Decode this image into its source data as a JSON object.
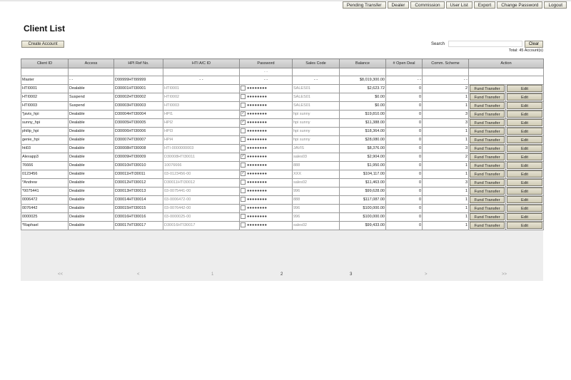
{
  "nav": {
    "items": [
      "Pending Transfer",
      "Dealer",
      "Commission",
      "User List",
      "Export",
      "Change Password",
      "Logout"
    ]
  },
  "page": {
    "title": "Client List",
    "create_label": "Create Account",
    "search_label": "Search",
    "search_value": "",
    "clear_label": "Clear",
    "total": "Total: 45 Account(s)"
  },
  "table": {
    "headers": [
      "Client ID",
      "Access",
      "HPI Ref No.",
      "HTI A/C ID",
      "Password",
      "Sales Code",
      "Balance",
      "# Open Deal",
      "Comm. Scheme",
      "Action"
    ],
    "filter_password": "- -",
    "master": {
      "client_id": "Master",
      "access": "- -",
      "ref": "D99999HTI99999",
      "ac": "- -",
      "password": "- -",
      "sales": "- -",
      "balance": "$8,019,300.00",
      "open": "- -",
      "comm": "- -"
    },
    "password_mask": "●●●●●●●●",
    "fund_label": "Fund Transfer",
    "edit_label": "Edit",
    "rows": [
      {
        "id": "HTI0001",
        "access": "Dealable",
        "ref": "D30001HTI30001",
        "ac": "HTI0001",
        "checked": false,
        "sales": "SALES01",
        "balance": "$2,623.72",
        "open": "0",
        "comm": "2"
      },
      {
        "id": "HTI0002",
        "access": "Suspend",
        "ref": "D30002HTI30002",
        "ac": "HTI0002",
        "checked": false,
        "sales": "SALES01",
        "balance": "$0.00",
        "open": "0",
        "comm": "1"
      },
      {
        "id": "HTI0003",
        "access": "Suspend",
        "ref": "D30003HTI30003",
        "ac": "HTI0003",
        "checked": false,
        "sales": "SALES01",
        "balance": "$0.00",
        "open": "0",
        "comm": "1"
      },
      {
        "id": "*javis_hpi",
        "access": "Dealable",
        "ref": "D30004HTI30004",
        "ac": "HPI1",
        "checked": true,
        "sales": "hpi sunny",
        "balance": "$19,810.00",
        "open": "0",
        "comm": "3"
      },
      {
        "id": "sunny_hpi",
        "access": "Dealable",
        "ref": "D30005HTI30005",
        "ac": "HPI2",
        "checked": true,
        "sales": "hpi sunny",
        "balance": "$11,388.00",
        "open": "0",
        "comm": "3"
      },
      {
        "id": "philip_hpi",
        "access": "Dealable",
        "ref": "D30006HTI30006",
        "ac": "HPI3",
        "checked": false,
        "sales": "hpi sunny",
        "balance": "$18,364.00",
        "open": "0",
        "comm": "1"
      },
      {
        "id": "genie_hpi",
        "access": "Dealable",
        "ref": "D30007HTI30007",
        "ac": "HPI4",
        "checked": false,
        "sales": "hpi sunny",
        "balance": "$28,080.00",
        "open": "0",
        "comm": "1"
      },
      {
        "id": "hti03",
        "access": "Dealable",
        "ref": "D30008HTI30008",
        "ac": "HTI-0000000003",
        "checked": false,
        "sales": "JAVIS",
        "balance": "$8,376.00",
        "open": "0",
        "comm": "3"
      },
      {
        "id": "Alexapp3",
        "access": "Dealable",
        "ref": "D30009HTI30009",
        "ac": "D30008HTI30011",
        "checked": true,
        "sales": "sales03",
        "balance": "$2,904.00",
        "open": "0",
        "comm": "2"
      },
      {
        "id": "76666",
        "access": "Dealable",
        "ref": "D30010HTI30010",
        "ac": "10076666",
        "checked": false,
        "sales": "888",
        "balance": "$1,950.00",
        "open": "0",
        "comm": "1"
      },
      {
        "id": "0123456",
        "access": "Dealable",
        "ref": "D30011HTI30011",
        "ac": "03-0123456-00",
        "checked": true,
        "sales": "XXX",
        "balance": "$104,117.00",
        "open": "0",
        "comm": "1"
      },
      {
        "id": "*Andrew",
        "access": "Dealable",
        "ref": "D30012HTI30012",
        "ac": "D30011HTI30012",
        "checked": false,
        "sales": "sales02",
        "balance": "$11,463.00",
        "open": "0",
        "comm": "3"
      },
      {
        "id": "*0075441",
        "access": "Dealable",
        "ref": "D30013HTI30013",
        "ac": "03-0075441-00",
        "checked": false,
        "sales": "996",
        "balance": "$99,628.00",
        "open": "0",
        "comm": "1"
      },
      {
        "id": "0006472",
        "access": "Dealable",
        "ref": "D30014HTI30014",
        "ac": "03-0006472-00",
        "checked": false,
        "sales": "888",
        "balance": "$117,087.00",
        "open": "0",
        "comm": "1"
      },
      {
        "id": "0076442",
        "access": "Dealable",
        "ref": "D30015HTI30015",
        "ac": "03-0076442-00",
        "checked": false,
        "sales": "996",
        "balance": "$100,000.00",
        "open": "0",
        "comm": "1"
      },
      {
        "id": "0000025",
        "access": "Dealable",
        "ref": "D30016HTI30016",
        "ac": "03-0000025-00",
        "checked": false,
        "sales": "996",
        "balance": "$100,000.00",
        "open": "0",
        "comm": "1"
      },
      {
        "id": "*Raphael",
        "access": "Dealable",
        "ref": "D30017HTI30017",
        "ac": "D30016HTI30017",
        "checked": false,
        "sales": "sales02",
        "balance": "$99,433.00",
        "open": "0",
        "comm": "1"
      }
    ]
  },
  "pager": {
    "first": "<<",
    "prev": "<",
    "pages": [
      "1",
      "2",
      "3"
    ],
    "next": ">",
    "last": ">>"
  }
}
